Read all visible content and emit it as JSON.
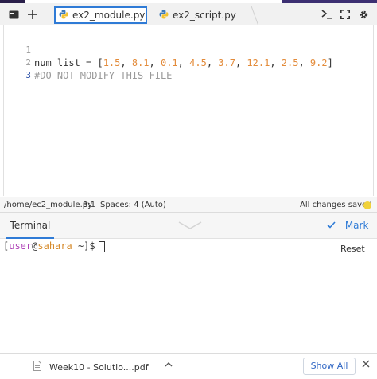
{
  "tabbar": {
    "icons": [
      "terminal-window-icon",
      "plus-icon"
    ],
    "tabs": [
      {
        "label": "ex2_module.py",
        "active": true,
        "icon": "python-icon"
      },
      {
        "label": "ex2_script.py",
        "active": false,
        "icon": "python-icon"
      }
    ],
    "right_icons": [
      "console-prompt-icon",
      "fullscreen-icon",
      "gear-icon"
    ]
  },
  "editor": {
    "lines": [
      {
        "number": "1",
        "tokens": [
          {
            "text": "num_list = [",
            "kind": "plain"
          },
          {
            "text": "1.5",
            "kind": "num"
          },
          {
            "text": ", ",
            "kind": "plain"
          },
          {
            "text": "8.1",
            "kind": "num"
          },
          {
            "text": ", ",
            "kind": "plain"
          },
          {
            "text": "0.1",
            "kind": "num"
          },
          {
            "text": ", ",
            "kind": "plain"
          },
          {
            "text": "4.5",
            "kind": "num"
          },
          {
            "text": ", ",
            "kind": "plain"
          },
          {
            "text": "3.7",
            "kind": "num"
          },
          {
            "text": ", ",
            "kind": "plain"
          },
          {
            "text": "12.1",
            "kind": "num"
          },
          {
            "text": ", ",
            "kind": "plain"
          },
          {
            "text": "2.5",
            "kind": "num"
          },
          {
            "text": ", ",
            "kind": "plain"
          },
          {
            "text": "9.2",
            "kind": "num"
          },
          {
            "text": "]",
            "kind": "plain"
          }
        ]
      },
      {
        "number": "2",
        "tokens": [
          {
            "text": "#DO NOT MODIFY THIS FILE",
            "kind": "cmt"
          }
        ]
      },
      {
        "number": "3",
        "tokens": []
      }
    ]
  },
  "status": {
    "path": "/home/ec2_module.py",
    "position": "3:1",
    "spaces": "Spaces: 4 (Auto)",
    "saved": "All changes saved",
    "saved_color": "#f1d23a"
  },
  "terminal": {
    "tab_label": "Terminal",
    "mark_label": "Mark",
    "reset_label": "Reset",
    "prompt": {
      "open": "[",
      "user": "user",
      "at": "@",
      "host": "sahara",
      "rest": " ~]$"
    }
  },
  "downloads": {
    "file_label": "Week10 - Solutio....pdf",
    "show_all": "Show All"
  },
  "colors": {
    "accent": "#2f7bd6",
    "number": "#e38b3a",
    "comment": "#9a9a9a"
  }
}
